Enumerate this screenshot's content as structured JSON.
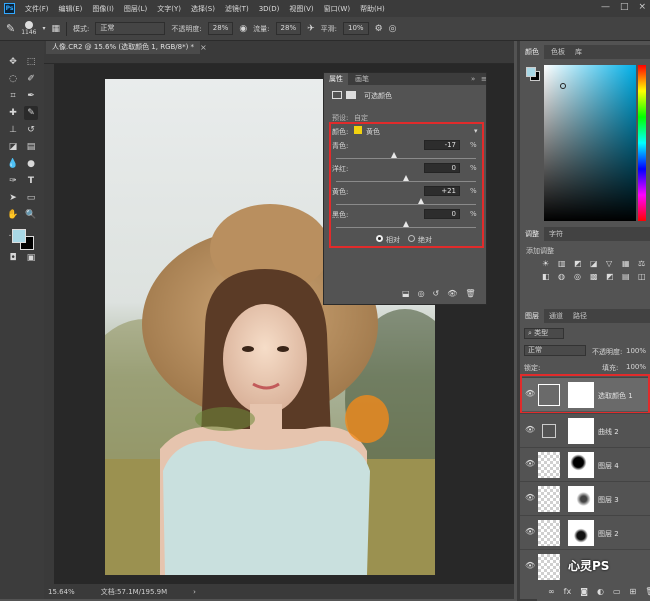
{
  "menubar": {
    "logo": "Ps",
    "items": [
      "文件(F)",
      "编辑(E)",
      "图像(I)",
      "图层(L)",
      "文字(Y)",
      "选择(S)",
      "滤镜(T)",
      "3D(D)",
      "视图(V)",
      "窗口(W)",
      "帮助(H)"
    ],
    "controls": [
      "—",
      "□",
      "×"
    ]
  },
  "options": {
    "brush_size": "1146",
    "mode_label": "模式:",
    "mode_value": "正常",
    "opacity_label": "不透明度:",
    "opacity_value": "28%",
    "flow_label": "流量:",
    "flow_value": "28%",
    "smoothing_label": "平滑:",
    "smoothing_value": "10%"
  },
  "document": {
    "tab_title": "人像.CR2 @ 15.6% (选取颜色 1, RGB/8*) *",
    "zoom": "15.64%",
    "doc_size": "文档:57.1M/195.9M"
  },
  "properties": {
    "tabs": [
      "属性",
      "画笔"
    ],
    "header_title": "可选颜色",
    "preset_label": "预设:",
    "preset_value": "自定",
    "colors_label": "颜色:",
    "colors_value": "黄色",
    "swatch_color": "#f2d20f",
    "sliders": [
      {
        "label": "青色:",
        "value": "-17",
        "pct": "%",
        "level": -17
      },
      {
        "label": "洋红:",
        "value": "0",
        "pct": "%",
        "level": 0
      },
      {
        "label": "黄色:",
        "value": "+21",
        "pct": "%",
        "level": 21
      },
      {
        "label": "黑色:",
        "value": "0",
        "pct": "%",
        "level": 0
      }
    ],
    "method_relative": "相对",
    "method_absolute": "绝对"
  },
  "right": {
    "color_tabs": [
      "颜色",
      "色板",
      "库"
    ],
    "adjust_tabs": [
      "调整",
      "字符"
    ],
    "add_adjust": "添加调整",
    "layer_tabs": [
      "图层",
      "通道",
      "路径"
    ],
    "kind_label": "类型",
    "blend_mode": "正常",
    "opacity_label": "不透明度:",
    "opacity_value": "100%",
    "lock_label": "锁定:",
    "fill_label": "填充:",
    "fill_value": "100%",
    "layers": [
      {
        "name": "选取颜色 1",
        "type": "adjust"
      },
      {
        "name": "曲线 2",
        "type": "adjust"
      },
      {
        "name": "图层 4",
        "type": "pixel"
      },
      {
        "name": "图层 3",
        "type": "pixel"
      },
      {
        "name": "图层 2",
        "type": "pixel"
      }
    ],
    "watermark": "心灵PS"
  },
  "colors": {
    "accent_red": "#e12b2b",
    "foreground": "#a8d8e6",
    "background": "#000000"
  }
}
